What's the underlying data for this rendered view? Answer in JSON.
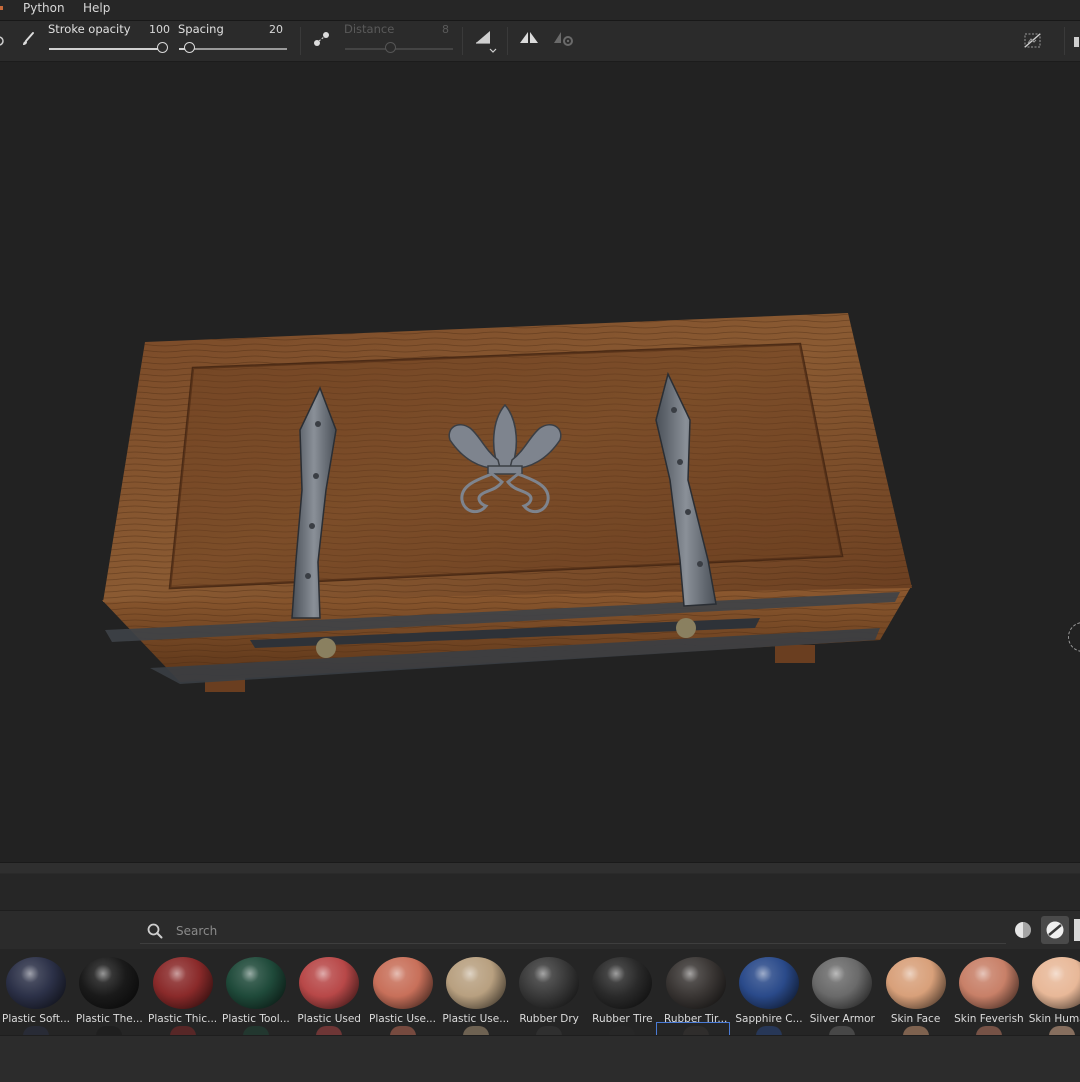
{
  "menubar": {
    "items": [
      "Python",
      "Help"
    ]
  },
  "toolbar": {
    "stroke_opacity": {
      "label": "Stroke opacity",
      "value": "100",
      "fraction": 1.0
    },
    "spacing": {
      "label": "Spacing",
      "value": "20",
      "fraction": 0.1
    },
    "distance": {
      "label": "Distance",
      "value": "8",
      "fraction": 0.4,
      "enabled": false
    },
    "icons": [
      "brush-icon",
      "lazy-mouse-icon",
      "angle-icon",
      "symmetry-icon",
      "symmetry-settings-icon",
      "hide-overlay-icon"
    ]
  },
  "shelf": {
    "search_placeholder": "Search",
    "view_modes": [
      "sphere-preview",
      "material-preview"
    ],
    "active_view": "material-preview",
    "selected": "Rubber Tir...",
    "materials": [
      {
        "label": "Plastic Soft...",
        "color": "#2c3148"
      },
      {
        "label": "Plastic The...",
        "color": "#1a1a1a"
      },
      {
        "label": "Plastic Thic...",
        "color": "#8a2a2a"
      },
      {
        "label": "Plastic Tool...",
        "color": "#1f4a3a"
      },
      {
        "label": "Plastic Used",
        "color": "#b84848"
      },
      {
        "label": "Plastic Use...",
        "color": "#c8705a"
      },
      {
        "label": "Plastic Use...",
        "color": "#b8a080"
      },
      {
        "label": "Rubber Dry",
        "color": "#3a3a3a"
      },
      {
        "label": "Rubber Tire",
        "color": "#2a2a2a"
      },
      {
        "label": "Rubber Tir...",
        "color": "#3a3634"
      },
      {
        "label": "Sapphire C...",
        "color": "#2a4a8a"
      },
      {
        "label": "Silver Armor",
        "color": "#6a6a6a"
      },
      {
        "label": "Skin Face",
        "color": "#d8a07a"
      },
      {
        "label": "Skin Feverish",
        "color": "#c88068"
      },
      {
        "label": "Skin Huma...",
        "color": "#e8b898"
      }
    ]
  }
}
